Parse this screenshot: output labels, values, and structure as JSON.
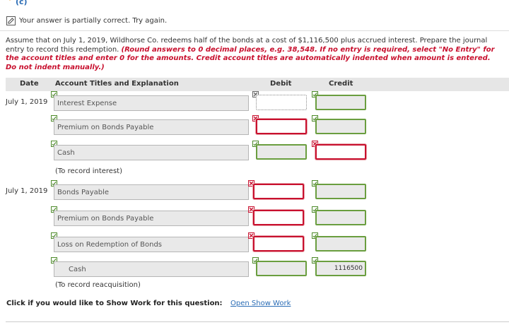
{
  "part": {
    "label": "(c)"
  },
  "status": {
    "message": "Your answer is partially correct.  Try again."
  },
  "problem": {
    "text": "Assume that on July 1, 2019, Wildhorse Co. redeems half of the bonds at a cost of $1,116,500 plus accrued interest. Prepare the journal entry to record this redemption. ",
    "instructions": "(Round answers to 0 decimal places, e.g. 38,548. If no entry is required, select \"No Entry\" for the account titles and enter 0 for the amounts. Credit account titles are automatically indented when amount is entered. Do not indent manually.)"
  },
  "table": {
    "headers": {
      "date": "Date",
      "account": "Account Titles and Explanation",
      "debit": "Debit",
      "credit": "Credit"
    },
    "entry1": {
      "date": "July 1, 2019",
      "rows": [
        {
          "account": "Interest Expense",
          "debit": "",
          "credit": ""
        },
        {
          "account": "Premium on Bonds Payable",
          "debit": "",
          "credit": ""
        },
        {
          "account": "Cash",
          "debit": "",
          "credit": ""
        }
      ],
      "memo": "(To record interest)"
    },
    "entry2": {
      "date": "July 1, 2019",
      "rows": [
        {
          "account": "Bonds Payable",
          "debit": "",
          "credit": ""
        },
        {
          "account": "Premium on Bonds Payable",
          "debit": "",
          "credit": ""
        },
        {
          "account": "Loss on Redemption of Bonds",
          "debit": "",
          "credit": ""
        },
        {
          "account": "Cash",
          "debit": "",
          "credit": "1116500"
        }
      ],
      "memo": "(To record reacquisition)"
    }
  },
  "showwork": {
    "prompt": "Click if you would like to Show Work for this question:",
    "link": "Open Show Work"
  },
  "colors": {
    "correct": "#6a9e3f",
    "incorrect": "#c8102e",
    "link": "#2a6cb5",
    "instruction": "#c8102e"
  }
}
